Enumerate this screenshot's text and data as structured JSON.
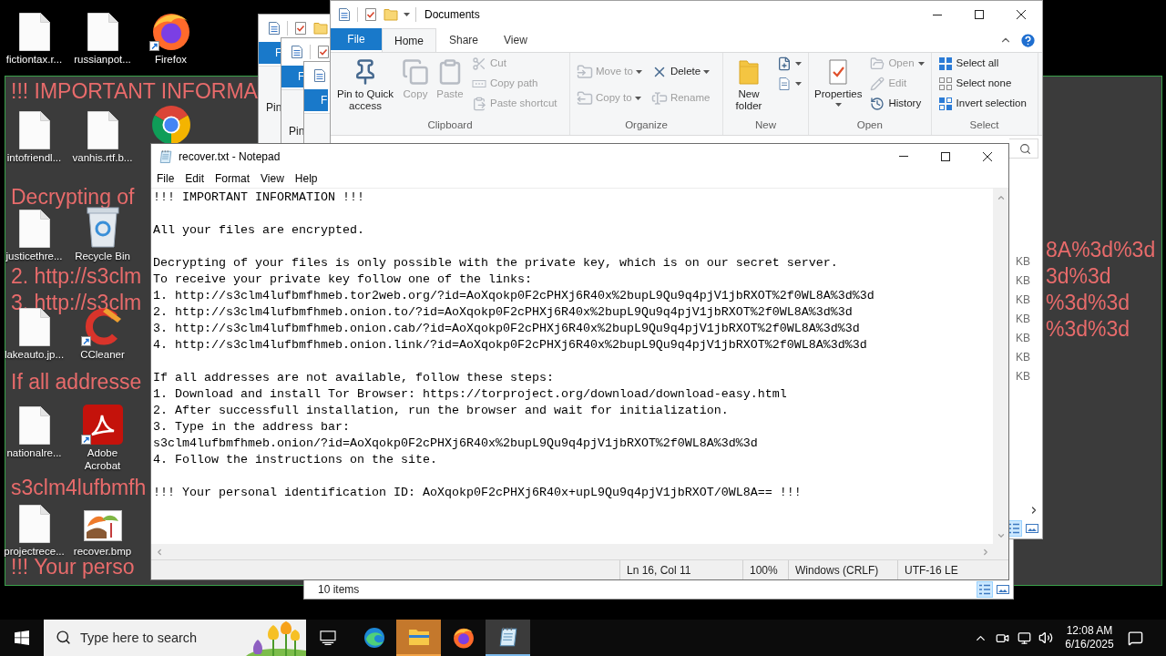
{
  "wallpaper": {
    "left_fragments": [
      "!!! IMPORTANT INFORMA",
      "Decrypting of",
      "2. http://s3clm",
      "3. http://s3clm",
      "If all addresse",
      "s3clm4lufbmfh",
      "!!! Your perso"
    ],
    "right_lines": [
      "8A%3d%3d",
      "3d%3d",
      "%3d%3d",
      "%3d%3d"
    ]
  },
  "desktop_icons": [
    [
      {
        "label": "fictiontax.r...",
        "kind": "file",
        "shortcut": false
      },
      {
        "label": "russianpot...",
        "kind": "file",
        "shortcut": false
      },
      {
        "label": "Firefox",
        "kind": "firefox",
        "shortcut": true
      }
    ],
    [
      {
        "label": "intofriendl...",
        "kind": "file",
        "shortcut": false
      },
      {
        "label": "vanhis.rtf.b...",
        "kind": "file",
        "shortcut": false
      },
      {
        "kind": "chrome",
        "shortcut": false
      }
    ],
    [
      {
        "label": "justicethre...",
        "kind": "file",
        "shortcut": false
      },
      {
        "label": "Recycle Bin",
        "kind": "recycle_bin",
        "shortcut": false
      }
    ],
    [
      {
        "label": "lakeauto.jp...",
        "kind": "file",
        "shortcut": false
      },
      {
        "label": "CCleaner",
        "kind": "ccleaner",
        "shortcut": true
      }
    ],
    [
      {
        "label": "nationalre...",
        "kind": "file",
        "shortcut": false
      },
      {
        "label": "Adobe Acrobat",
        "kind": "acrobat",
        "shortcut": true
      }
    ],
    [
      {
        "label": "projectrece...",
        "kind": "file",
        "shortcut": false
      },
      {
        "label": "recover.bmp",
        "kind": "image",
        "shortcut": false
      }
    ]
  ],
  "background_windows": [
    {
      "file_tab": "F",
      "ribbon_text": "Pin"
    },
    {
      "file_tab": "F",
      "ribbon_text": "Pin"
    },
    {
      "file_tab": "F",
      "status": "10 items",
      "view_buttons": [
        {
          "kind": "details",
          "selected": true
        },
        {
          "kind": "large_icons",
          "selected": false
        }
      ]
    }
  ],
  "explorer": {
    "title": "Documents",
    "tabs": [
      {
        "label": "File",
        "kind": "file",
        "selected": false
      },
      {
        "label": "Home",
        "kind": "tab",
        "selected": true
      },
      {
        "label": "Share",
        "kind": "tab",
        "selected": false
      },
      {
        "label": "View",
        "kind": "tab",
        "selected": false
      }
    ],
    "ribbon_groups": [
      {
        "label": "Clipboard",
        "items": [
          {
            "label": "Pin to Quick access",
            "kind": "large",
            "disabled": false,
            "dropdown": false
          },
          {
            "label": "Copy",
            "kind": "large",
            "disabled": true,
            "dropdown": false
          },
          {
            "label": "Paste",
            "kind": "large",
            "disabled": true,
            "dropdown": false
          },
          {
            "label": "Cut",
            "kind": "small",
            "disabled": true,
            "dropdown": false
          },
          {
            "label": "Copy path",
            "kind": "small",
            "disabled": true,
            "dropdown": false
          },
          {
            "label": "Paste shortcut",
            "kind": "small",
            "disabled": true,
            "dropdown": false
          }
        ]
      },
      {
        "label": "Organize",
        "items": [
          {
            "label": "Move to",
            "kind": "medium",
            "disabled": true,
            "dropdown": true
          },
          {
            "label": "Copy to",
            "kind": "medium",
            "disabled": true,
            "dropdown": true
          },
          {
            "label": "Delete",
            "kind": "medium",
            "disabled": false,
            "dropdown": true
          },
          {
            "label": "Rename",
            "kind": "medium",
            "disabled": true,
            "dropdown": false
          }
        ]
      },
      {
        "label": "New",
        "items": [
          {
            "label": "New folder",
            "kind": "large",
            "disabled": false,
            "dropdown": false
          },
          {
            "kind": "icon",
            "disabled": false,
            "dropdown": true
          },
          {
            "kind": "icon",
            "disabled": false,
            "dropdown": true
          }
        ]
      },
      {
        "label": "Open",
        "items": [
          {
            "label": "Properties",
            "kind": "large",
            "disabled": false,
            "dropdown": true
          },
          {
            "label": "Open",
            "kind": "small",
            "disabled": true,
            "dropdown": true
          },
          {
            "label": "Edit",
            "kind": "small",
            "disabled": true,
            "dropdown": false
          },
          {
            "label": "History",
            "kind": "small",
            "disabled": false,
            "dropdown": false
          }
        ]
      },
      {
        "label": "Select",
        "items": [
          {
            "label": "Select all",
            "kind": "small",
            "disabled": false,
            "dropdown": false
          },
          {
            "label": "Select none",
            "kind": "small",
            "disabled": false,
            "dropdown": false
          },
          {
            "label": "Invert selection",
            "kind": "small",
            "disabled": false,
            "dropdown": false
          }
        ]
      }
    ],
    "sizes": [
      "KB",
      "KB",
      "KB",
      "KB",
      "KB",
      "KB",
      "KB"
    ],
    "view_buttons": [
      {
        "kind": "details",
        "selected": true
      },
      {
        "kind": "large_icons",
        "selected": false
      }
    ]
  },
  "notepad": {
    "title": "recover.txt - Notepad",
    "menu": [
      "File",
      "Edit",
      "Format",
      "View",
      "Help"
    ],
    "paragraphs": [
      [
        "!!! IMPORTANT INFORMATION !!!"
      ],
      [
        "All your files are encrypted."
      ],
      [
        "Decrypting of your files is only possible with the private key, which is on our secret server.",
        "To receive your private key follow one of the links:",
        "1. http://s3clm4lufbmfhmeb.tor2web.org/?id=AoXqokp0F2cPHXj6R40x%2bupL9Qu9q4pjV1jbRXOT%2f0WL8A%3d%3d",
        "2. http://s3clm4lufbmfhmeb.onion.to/?id=AoXqokp0F2cPHXj6R40x%2bupL9Qu9q4pjV1jbRXOT%2f0WL8A%3d%3d",
        "3. http://s3clm4lufbmfhmeb.onion.cab/?id=AoXqokp0F2cPHXj6R40x%2bupL9Qu9q4pjV1jbRXOT%2f0WL8A%3d%3d",
        "4. http://s3clm4lufbmfhmeb.onion.link/?id=AoXqokp0F2cPHXj6R40x%2bupL9Qu9q4pjV1jbRXOT%2f0WL8A%3d%3d"
      ],
      [
        "If all addresses are not available, follow these steps:",
        "1. Download and install Tor Browser: https://torproject.org/download/download-easy.html",
        "2. After successfull installation, run the browser and wait for initialization.",
        "3. Type in the address bar:",
        "s3clm4lufbmfhmeb.onion/?id=AoXqokp0F2cPHXj6R40x%2bupL9Qu9q4pjV1jbRXOT%2f0WL8A%3d%3d",
        "4. Follow the instructions on the site."
      ],
      [
        "!!! Your personal identification ID: AoXqokp0F2cPHXj6R40x+upL9Qu9q4pjV1jbRXOT/0WL8A== !!!"
      ]
    ],
    "status": [
      "Ln 16, Col 11",
      "100%",
      "Windows (CRLF)",
      "UTF-16 LE"
    ]
  },
  "taskbar": {
    "search": {
      "placeholder": "Type here to search"
    },
    "apps": [
      {
        "kind": "edge",
        "active": false,
        "flashing": false
      },
      {
        "kind": "explorer",
        "active": false,
        "flashing": true
      },
      {
        "kind": "firefox",
        "active": false,
        "flashing": false
      },
      {
        "kind": "notepad",
        "active": true,
        "flashing": false
      }
    ],
    "clock": {
      "time": "12:08 AM",
      "date": "6/16/2025"
    }
  }
}
